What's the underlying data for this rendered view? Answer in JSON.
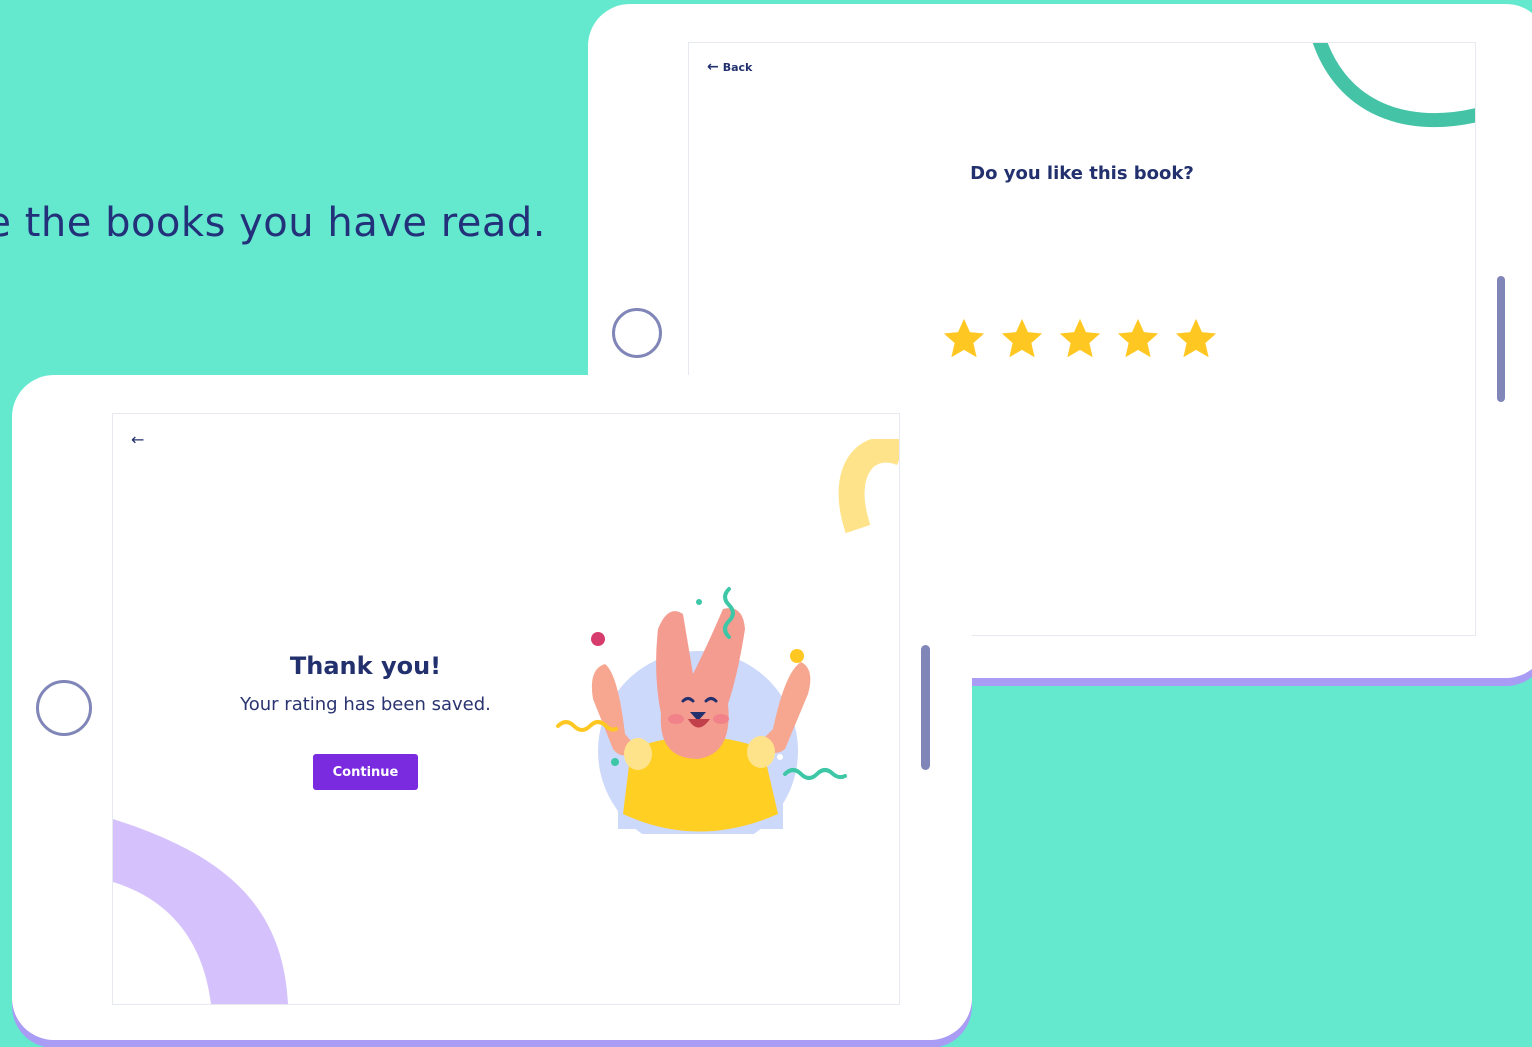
{
  "headline": "te the books you have read.",
  "back_screen": {
    "back_label": "Back",
    "question": "Do you like this book?",
    "rating": 5,
    "max_rating": 5,
    "star_color": "#ffc722"
  },
  "front_screen": {
    "title": "Thank you!",
    "subtitle": "Your rating has been saved.",
    "continue_label": "Continue",
    "accent": "#7a2be0",
    "illustration": "happy-bunny-confetti"
  }
}
